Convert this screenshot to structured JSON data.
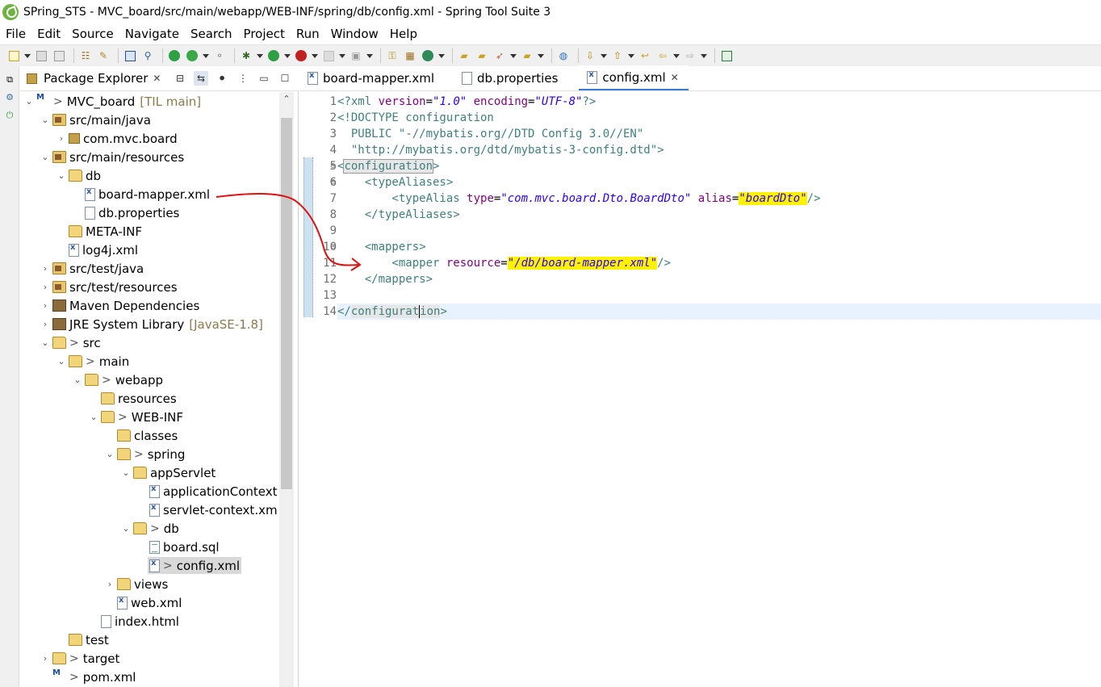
{
  "window": {
    "title": "SPring_STS - MVC_board/src/main/webapp/WEB-INF/spring/db/config.xml - Spring Tool Suite 3"
  },
  "menubar": [
    "File",
    "Edit",
    "Source",
    "Navigate",
    "Search",
    "Project",
    "Run",
    "Window",
    "Help"
  ],
  "explorer": {
    "title": "Package Explorer",
    "tree": [
      {
        "label": "MVC_board",
        "decoration": "[TIL main]",
        "gt": ">",
        "icon": "maven-project-icon"
      },
      {
        "label": "src/main/java",
        "icon": "source-folder-icon"
      },
      {
        "label": "com.mvc.board",
        "icon": "package-icon"
      },
      {
        "label": "src/main/resources",
        "icon": "source-folder-icon"
      },
      {
        "label": "db",
        "icon": "folder-icon"
      },
      {
        "label": "board-mapper.xml",
        "icon": "xml-file-icon"
      },
      {
        "label": "db.properties",
        "icon": "properties-file-icon"
      },
      {
        "label": "META-INF",
        "icon": "folder-icon"
      },
      {
        "label": "log4j.xml",
        "icon": "xml-file-icon"
      },
      {
        "label": "src/test/java",
        "icon": "source-folder-icon"
      },
      {
        "label": "src/test/resources",
        "icon": "source-folder-icon"
      },
      {
        "label": "Maven Dependencies",
        "icon": "library-icon"
      },
      {
        "label": "JRE System Library",
        "decoration": "[JavaSE-1.8]",
        "icon": "library-icon"
      },
      {
        "label": "src",
        "gt": ">",
        "icon": "folder-icon"
      },
      {
        "label": "main",
        "gt": ">",
        "icon": "folder-icon"
      },
      {
        "label": "webapp",
        "gt": ">",
        "icon": "folder-icon"
      },
      {
        "label": "resources",
        "icon": "folder-icon"
      },
      {
        "label": "WEB-INF",
        "gt": ">",
        "icon": "folder-icon"
      },
      {
        "label": "classes",
        "icon": "folder-icon"
      },
      {
        "label": "spring",
        "gt": ">",
        "icon": "folder-icon"
      },
      {
        "label": "appServlet",
        "icon": "folder-icon"
      },
      {
        "label": "applicationContext.x",
        "icon": "xml-file-icon"
      },
      {
        "label": "servlet-context.xml",
        "icon": "xml-file-icon"
      },
      {
        "label": "db",
        "gt": ">",
        "icon": "folder-icon"
      },
      {
        "label": "board.sql",
        "icon": "sql-file-icon"
      },
      {
        "label": "config.xml",
        "gt": ">",
        "icon": "xml-file-icon"
      },
      {
        "label": "views",
        "icon": "folder-icon"
      },
      {
        "label": "web.xml",
        "icon": "xml-file-icon"
      },
      {
        "label": "index.html",
        "icon": "html-file-icon"
      },
      {
        "label": "test",
        "icon": "folder-icon"
      },
      {
        "label": "target",
        "gt": ">",
        "icon": "folder-icon"
      },
      {
        "label": "pom.xml",
        "gt": ">",
        "icon": "maven-file-icon"
      }
    ]
  },
  "editor": {
    "tabs": [
      {
        "label": "board-mapper.xml"
      },
      {
        "label": "db.properties"
      },
      {
        "label": "config.xml"
      }
    ],
    "line_numbers": [
      "1",
      "2",
      "3",
      "4",
      "5",
      "6",
      "7",
      "8",
      "9",
      "10",
      "11",
      "12",
      "13",
      "14"
    ],
    "code": {
      "l1_a": "<?xml ",
      "l1_b": "version",
      "l1_c": "=",
      "l1_d": "\"1.0\"",
      "l1_e": " encoding",
      "l1_f": "=",
      "l1_g": "\"UTF-8\"",
      "l1_h": "?>",
      "l2": "<!DOCTYPE configuration",
      "l3": "  PUBLIC \"-//mybatis.org//DTD Config 3.0//EN\"",
      "l4": "  \"http://mybatis.org/dtd/mybatis-3-config.dtd\">",
      "l5_a": "<",
      "l5_b": "configuration",
      "l5_c": ">",
      "l6": "    <typeAliases>",
      "l7_a": "        <typeAlias ",
      "l7_b": "type",
      "l7_c": "=",
      "l7_d": "\"com.mvc.board.Dto.BoardDto\"",
      "l7_e": " alias",
      "l7_f": "=",
      "l7_g": "\"boardDto\"",
      "l7_h": "/>",
      "l8": "    </typeAliases>",
      "l10": "    <mappers>",
      "l11_a": "        <mapper ",
      "l11_b": "resource",
      "l11_c": "=",
      "l11_d": "\"/db/board-mapper.xml\"",
      "l11_e": "/>",
      "l12": "    </mappers>",
      "l14_a": "</",
      "l14_b": "configurat",
      "l14_c": "ion",
      "l14_d": ">"
    }
  },
  "colors": {
    "tag": "#3f7f7f",
    "attribute": "#7f007f",
    "string": "#2a00ff",
    "highlight": "#fff200",
    "annotation_arrow": "#e01010"
  }
}
